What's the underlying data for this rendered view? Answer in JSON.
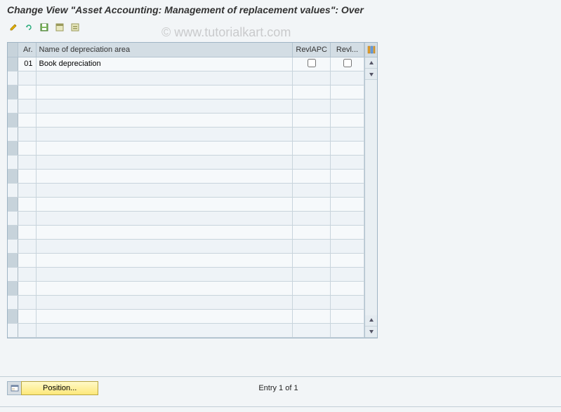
{
  "title": "Change View \"Asset Accounting: Management of replacement values\": Over",
  "watermark": "© www.tutorialkart.com",
  "toolbar": {
    "btn1": "display-change-icon",
    "btn2": "undo-icon",
    "btn3": "save-icon",
    "btn4": "select-all-icon",
    "btn5": "deselect-all-icon"
  },
  "table": {
    "headers": {
      "ar": "Ar.",
      "name": "Name of depreciation area",
      "revapc": "RevlAPC",
      "revl": "Revl..."
    },
    "rows": [
      {
        "ar": "01",
        "name": "Book depreciation",
        "revapc": false,
        "revl": false
      },
      {
        "ar": "",
        "name": "",
        "revapc": null,
        "revl": null
      },
      {
        "ar": "",
        "name": "",
        "revapc": null,
        "revl": null
      },
      {
        "ar": "",
        "name": "",
        "revapc": null,
        "revl": null
      },
      {
        "ar": "",
        "name": "",
        "revapc": null,
        "revl": null
      },
      {
        "ar": "",
        "name": "",
        "revapc": null,
        "revl": null
      },
      {
        "ar": "",
        "name": "",
        "revapc": null,
        "revl": null
      },
      {
        "ar": "",
        "name": "",
        "revapc": null,
        "revl": null
      },
      {
        "ar": "",
        "name": "",
        "revapc": null,
        "revl": null
      },
      {
        "ar": "",
        "name": "",
        "revapc": null,
        "revl": null
      },
      {
        "ar": "",
        "name": "",
        "revapc": null,
        "revl": null
      },
      {
        "ar": "",
        "name": "",
        "revapc": null,
        "revl": null
      },
      {
        "ar": "",
        "name": "",
        "revapc": null,
        "revl": null
      },
      {
        "ar": "",
        "name": "",
        "revapc": null,
        "revl": null
      },
      {
        "ar": "",
        "name": "",
        "revapc": null,
        "revl": null
      },
      {
        "ar": "",
        "name": "",
        "revapc": null,
        "revl": null
      },
      {
        "ar": "",
        "name": "",
        "revapc": null,
        "revl": null
      },
      {
        "ar": "",
        "name": "",
        "revapc": null,
        "revl": null
      },
      {
        "ar": "",
        "name": "",
        "revapc": null,
        "revl": null
      },
      {
        "ar": "",
        "name": "",
        "revapc": null,
        "revl": null
      }
    ]
  },
  "footer": {
    "position_label": "Position...",
    "entry_text": "Entry 1 of 1"
  }
}
